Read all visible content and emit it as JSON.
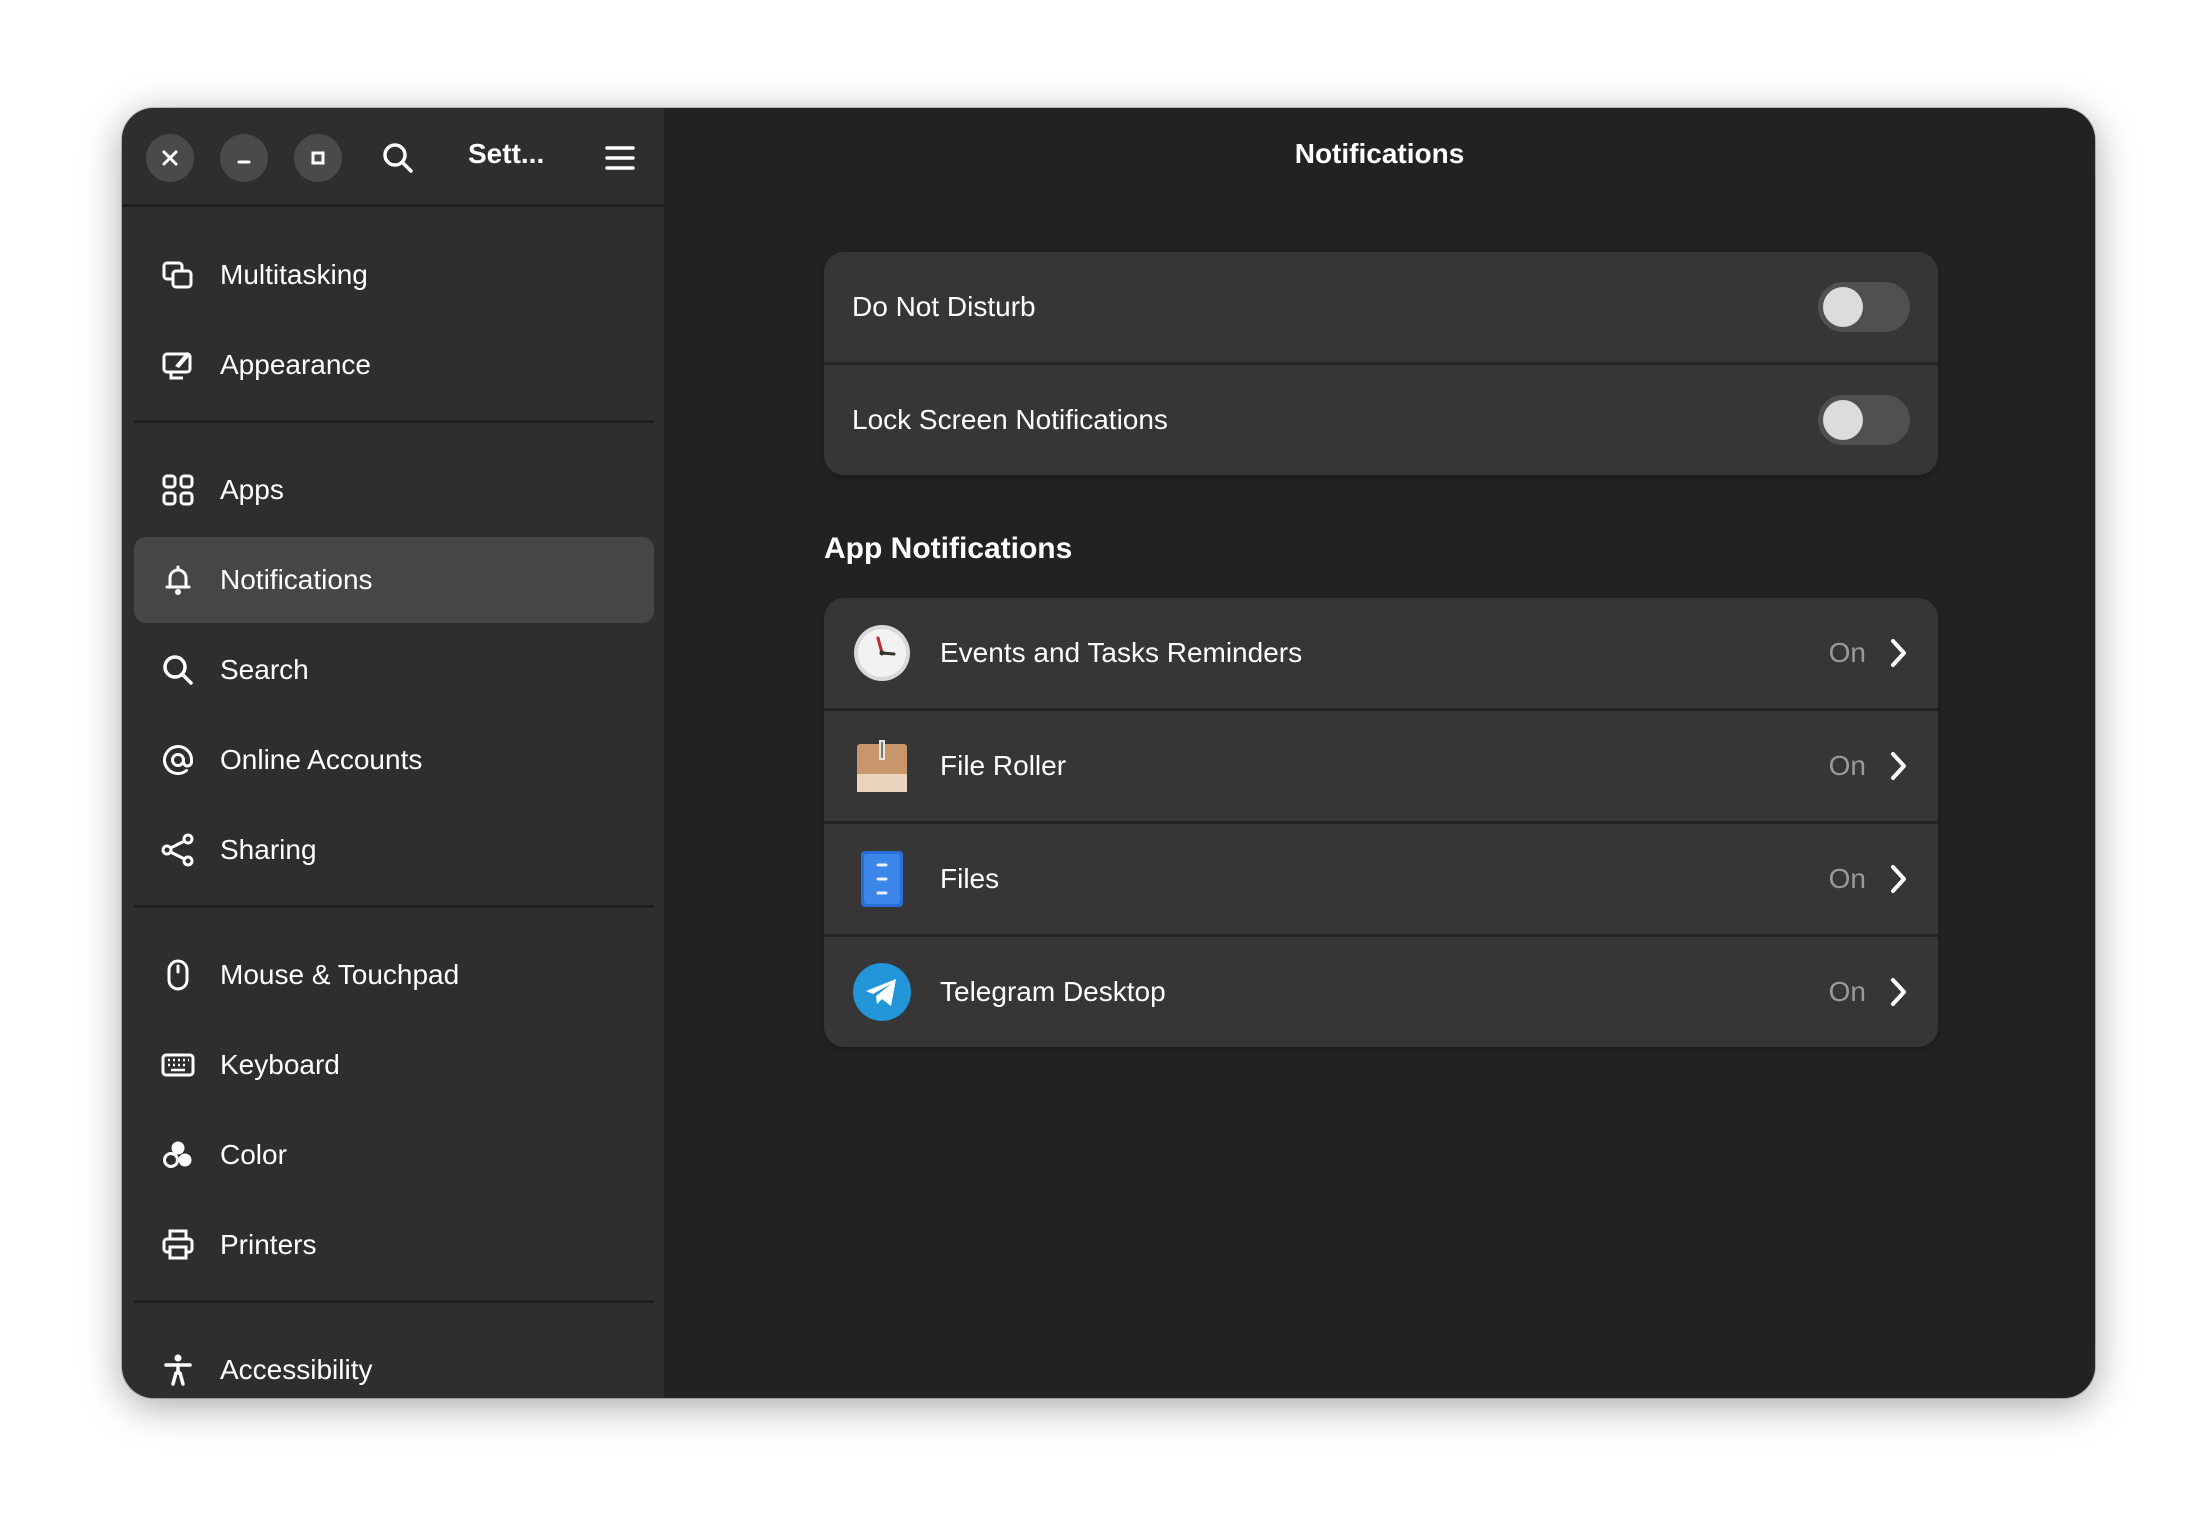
{
  "window": {
    "app_title": "Sett...",
    "page_title": "Notifications"
  },
  "header_icons": [
    "close-icon",
    "minimize-icon",
    "maximize-icon",
    "search-icon",
    "menu-icon"
  ],
  "sidebar": {
    "items": [
      {
        "label": "Multitasking",
        "icon": "multitasking-icon"
      },
      {
        "label": "Appearance",
        "icon": "appearance-icon"
      },
      {
        "label": "Apps",
        "icon": "apps-icon"
      },
      {
        "label": "Notifications",
        "icon": "bell-icon",
        "selected": true
      },
      {
        "label": "Search",
        "icon": "search-icon"
      },
      {
        "label": "Online Accounts",
        "icon": "at-icon"
      },
      {
        "label": "Sharing",
        "icon": "share-icon"
      },
      {
        "label": "Mouse & Touchpad",
        "icon": "mouse-icon"
      },
      {
        "label": "Keyboard",
        "icon": "keyboard-icon"
      },
      {
        "label": "Color",
        "icon": "color-icon"
      },
      {
        "label": "Printers",
        "icon": "printer-icon"
      },
      {
        "label": "Accessibility",
        "icon": "accessibility-icon"
      }
    ]
  },
  "settings": {
    "do_not_disturb": {
      "label": "Do Not Disturb",
      "enabled": false
    },
    "lock_screen": {
      "label": "Lock Screen Notifications",
      "enabled": false
    }
  },
  "app_notifications": {
    "title": "App Notifications",
    "apps": [
      {
        "label": "Events and Tasks Reminders",
        "status": "On",
        "icon": "clock-icon"
      },
      {
        "label": "File Roller",
        "status": "On",
        "icon": "archive-icon"
      },
      {
        "label": "Files",
        "status": "On",
        "icon": "files-icon"
      },
      {
        "label": "Telegram Desktop",
        "status": "On",
        "icon": "telegram-icon"
      }
    ]
  },
  "colors": {
    "window_bg": "#222222",
    "sidebar_bg": "#2e2e2e",
    "card_bg": "#363636",
    "selected_bg": "#464646",
    "text": "#ffffff",
    "muted_text": "#9a9a9a"
  }
}
